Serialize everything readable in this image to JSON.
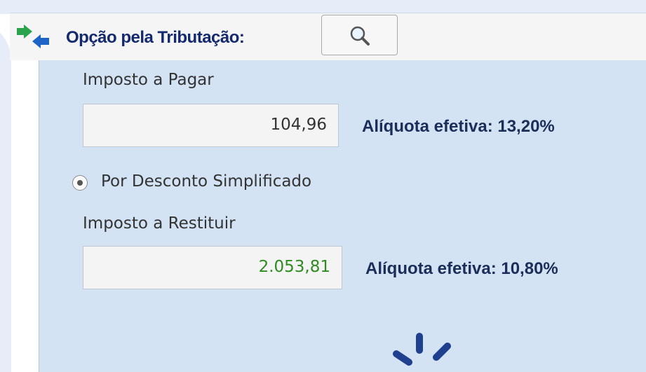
{
  "header": {
    "title": "Opção pela Tributação:",
    "icon": "swap-arrows-icon",
    "search_icon": "magnifier-icon"
  },
  "legal": {
    "amount_label": "Imposto a Pagar",
    "amount_value": "104,96",
    "rate_text": "Alíquota efetiva: 13,20%"
  },
  "simplified": {
    "option_label": "Por Desconto Simplificado",
    "selected": true,
    "amount_label": "Imposto a Restituir",
    "amount_value": "2.053,81",
    "rate_text": "Alíquota efetiva: 10,80%"
  },
  "colors": {
    "panel": "#d3e3f4",
    "title": "#142a6e",
    "payable_value": "#333333",
    "refund_value": "#2e8b1f",
    "spinner": "#1f3f8f"
  },
  "loading_indicator": "spinner-icon"
}
